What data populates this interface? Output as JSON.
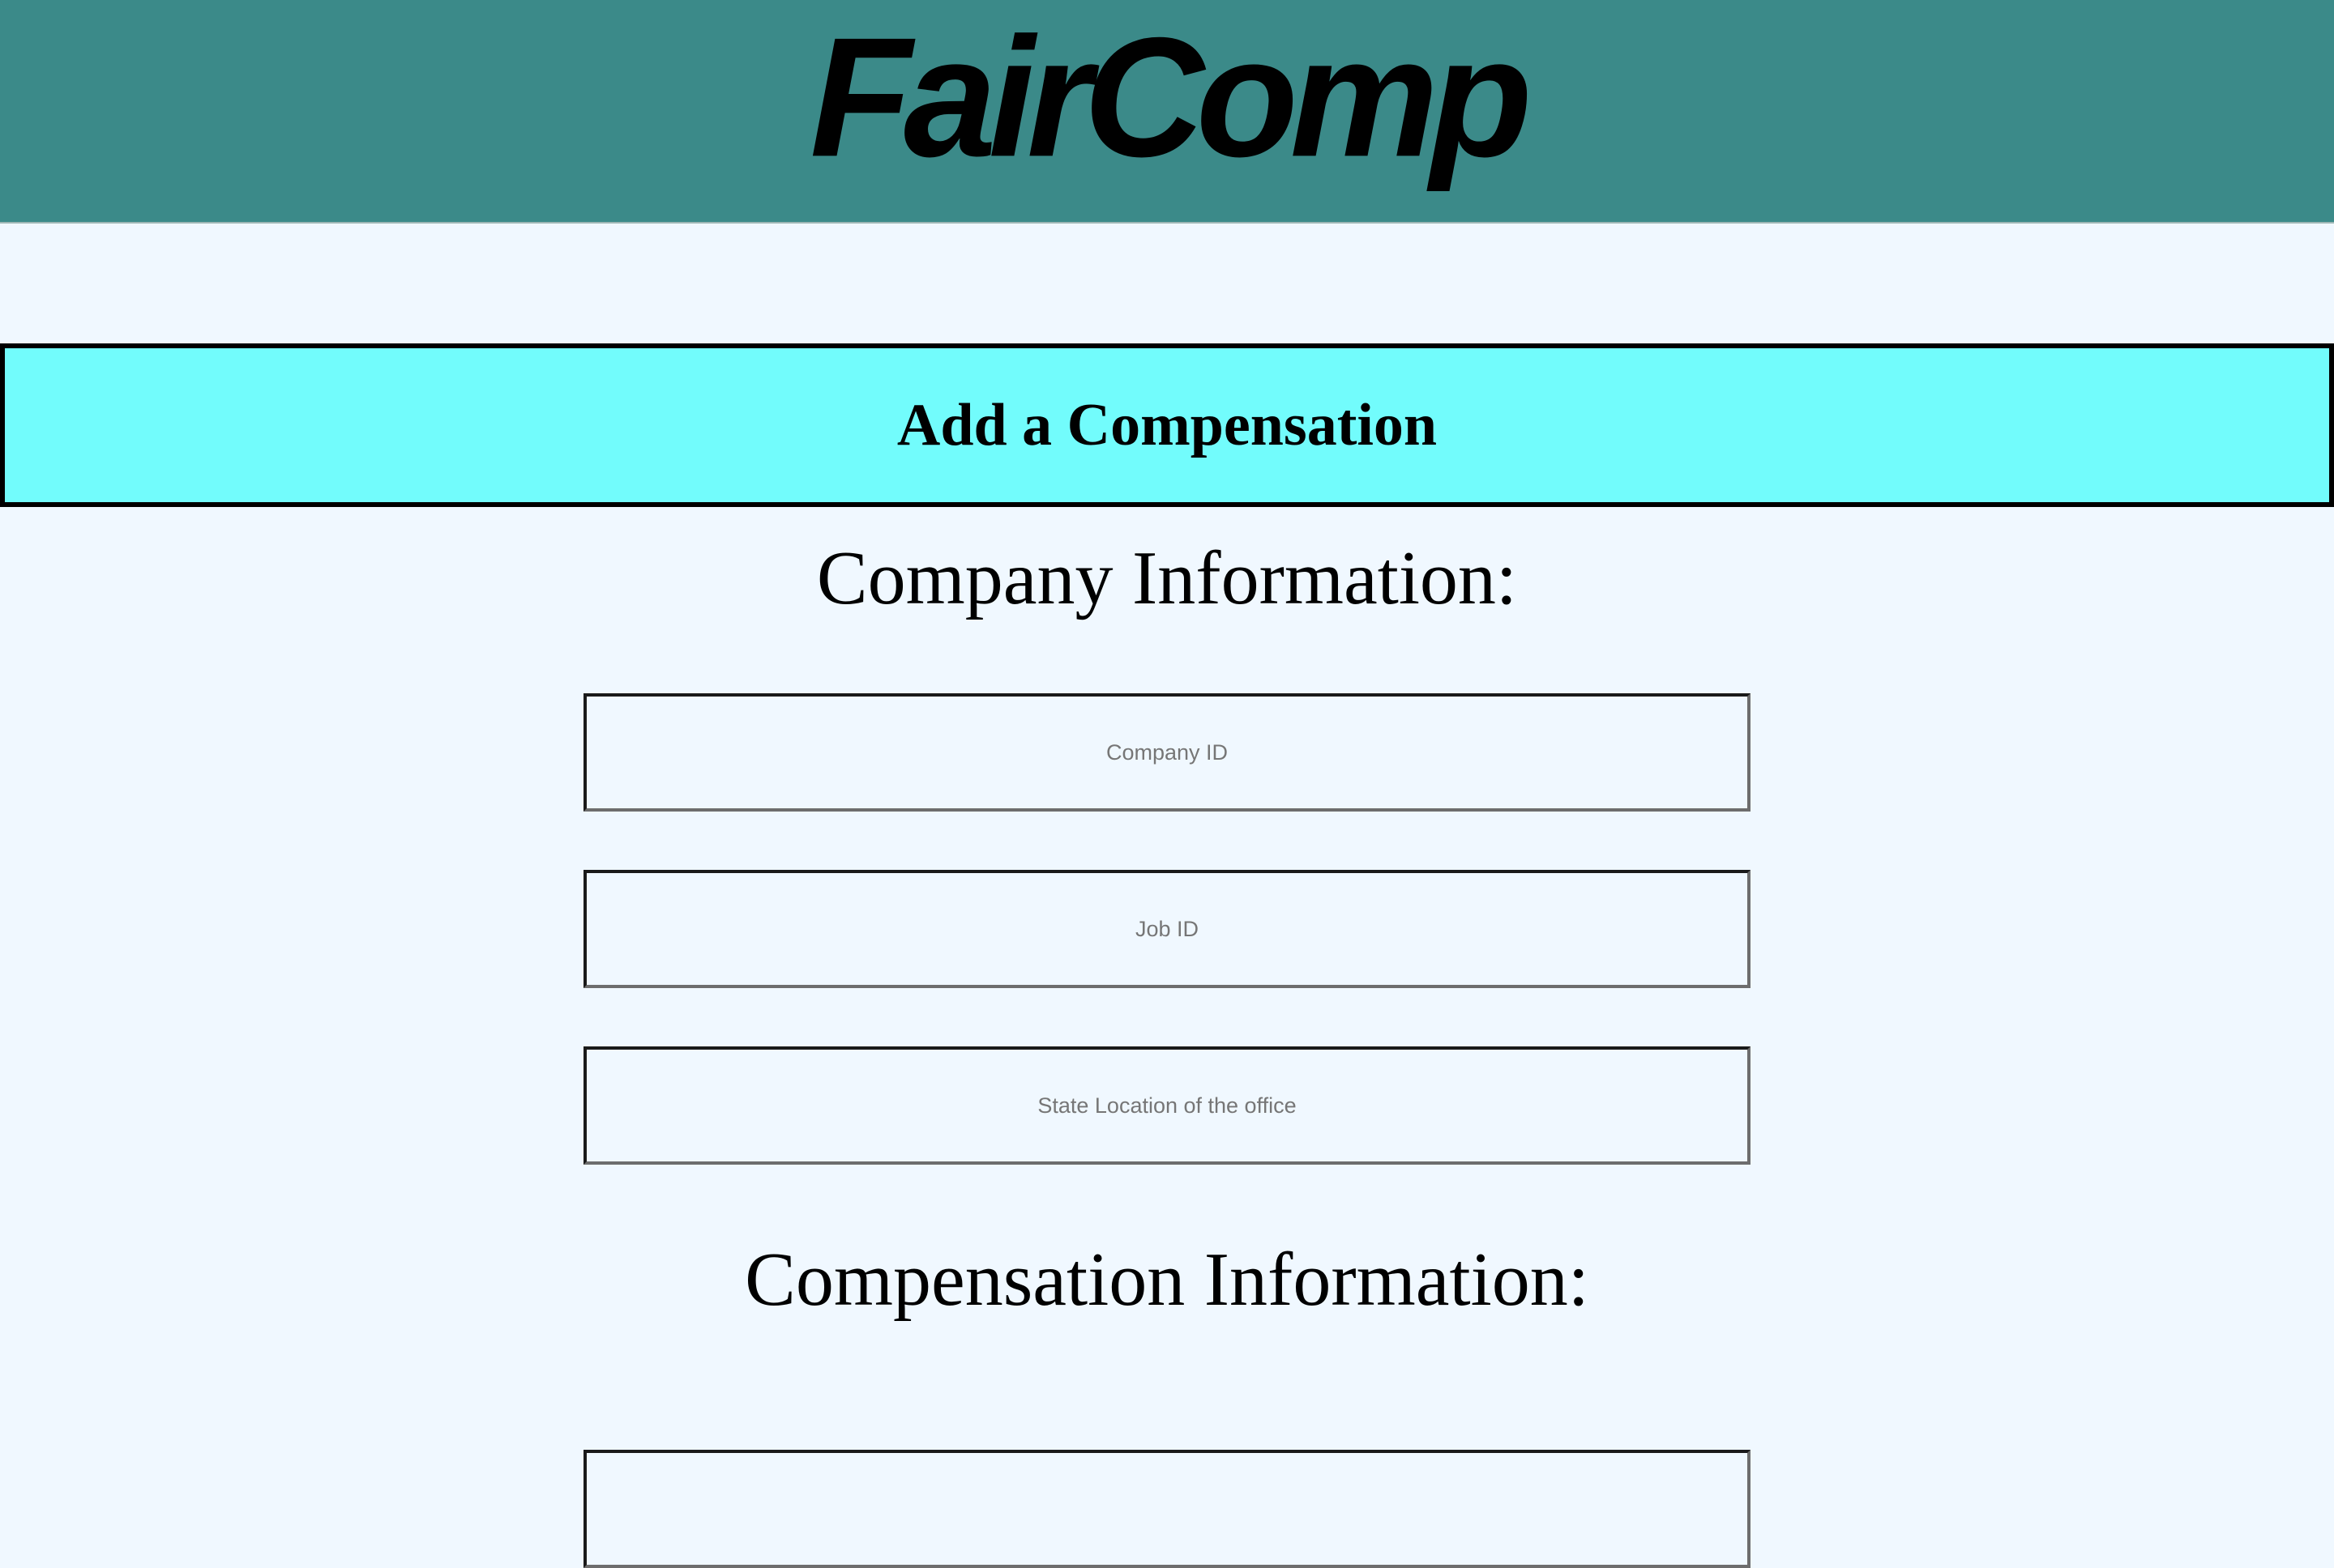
{
  "header": {
    "logo_text": "FairComp",
    "background_color": "#3b8a89"
  },
  "banner": {
    "title": "Add a Compensation",
    "background_color": "#72fcfc"
  },
  "company_section": {
    "heading": "Company Information:",
    "fields": [
      {
        "placeholder": "Company ID",
        "value": ""
      },
      {
        "placeholder": "Job ID",
        "value": ""
      },
      {
        "placeholder": "State Location of the office",
        "value": ""
      }
    ]
  },
  "compensation_section": {
    "heading": "Compensation Information:",
    "fields": [
      {
        "placeholder": "",
        "value": ""
      }
    ]
  },
  "colors": {
    "page_background": "#f0f8ff",
    "text": "#000000"
  }
}
